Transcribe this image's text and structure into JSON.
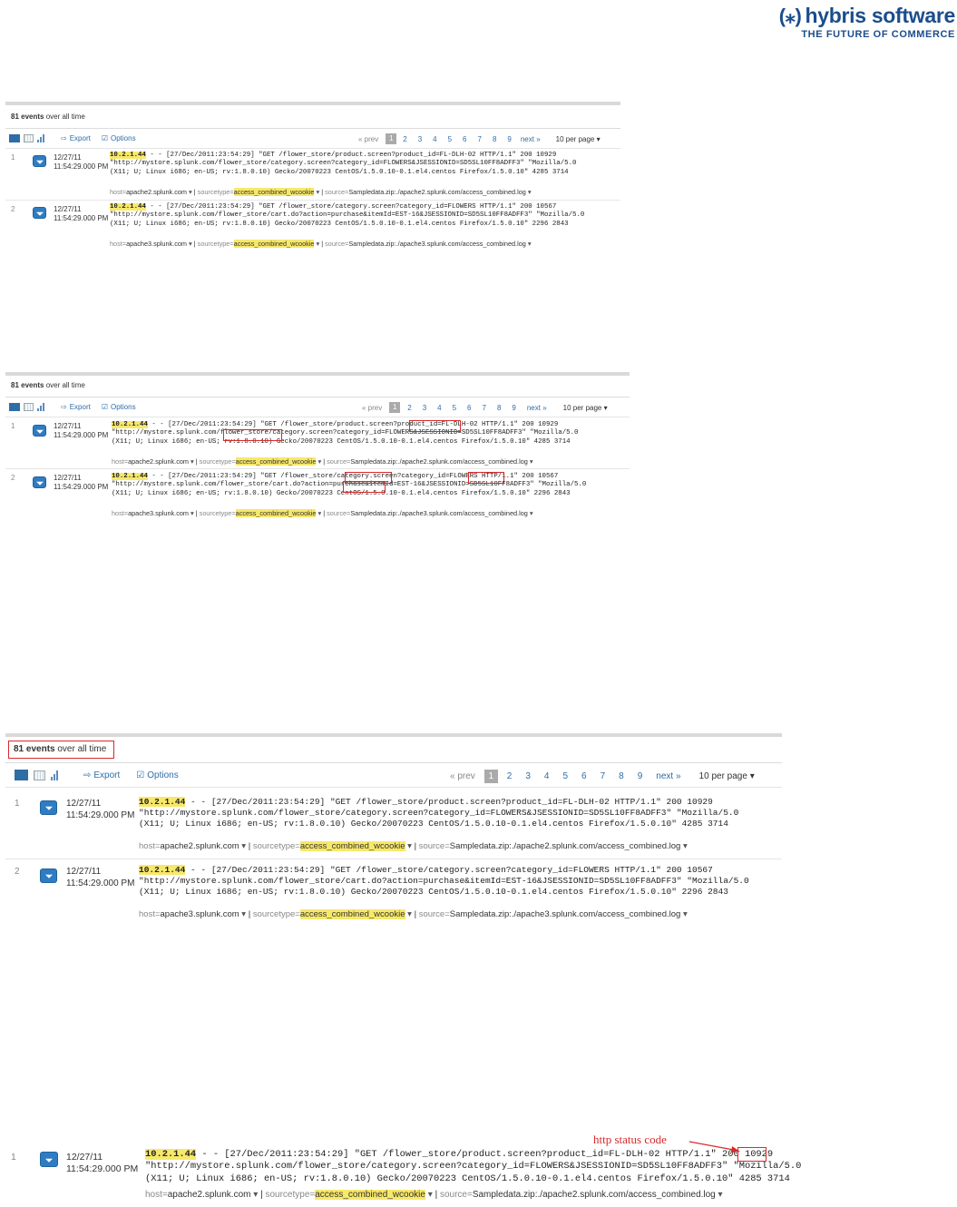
{
  "logo": {
    "name": "hybris software",
    "tagline": "THE FUTURE OF COMMERCE"
  },
  "screens": [
    {
      "count": {
        "num": "81 events",
        "rest": " over all time"
      },
      "toolbar": {
        "export": "Export",
        "options": "Options"
      },
      "pager": {
        "prev": "« prev",
        "pages": [
          "1",
          "2",
          "3",
          "4",
          "5",
          "6",
          "7",
          "8",
          "9"
        ],
        "next": "next »",
        "per_page": "10 per page"
      },
      "events": [
        {
          "num": "1",
          "date": "12/27/11",
          "time": "11:54:29.000 PM",
          "ip": "10.2.1.44",
          "line1": " - - [27/Dec/2011:23:54:29] \"GET /flower_store/product.screen?product_id=FL-DLH-02 HTTP/1.1\" 200 10929",
          "line2": "\"http://mystore.splunk.com/flower_store/category.screen?category_id=FLOWERS&JSESSIONID=SD5SL10FF8ADFF3\" \"Mozilla/5.0",
          "line3": "(X11; U; Linux i686; en-US; rv:1.8.0.10) Gecko/20070223 CentOS/1.5.0.10-0.1.el4.centos Firefox/1.5.0.10\" 4285 3714",
          "host": "apache2.splunk.com",
          "sourcetype": "access_combined_wcookie",
          "source": "Sampledata.zip:./apache2.splunk.com/access_combined.log"
        },
        {
          "num": "2",
          "date": "12/27/11",
          "time": "11:54:29.000 PM",
          "ip": "10.2.1.44",
          "line1": " - - [27/Dec/2011:23:54:29] \"GET /flower_store/category.screen?category_id=FLOWERS HTTP/1.1\" 200 10567",
          "line2": "\"http://mystore.splunk.com/flower_store/cart.do?action=purchase&itemId=EST-16&JSESSIONID=SD5SL10FF8ADFF3\" \"Mozilla/5.0",
          "line3": "(X11; U; Linux i686; en-US; rv:1.8.0.10) Gecko/20070223 CentOS/1.5.0.10-0.1.el4.centos Firefox/1.5.0.10\" 2296 2843",
          "host": "apache3.splunk.com",
          "sourcetype": "access_combined_wcookie",
          "source": "Sampledata.zip:./apache3.splunk.com/access_combined.log"
        }
      ]
    }
  ],
  "fields": {
    "host": "host=",
    "sourcetype": "sourcetype=",
    "source": "source=",
    "sep": "|",
    "dd": "▾"
  },
  "annotation": {
    "http_status": "http status code",
    "status_value": "200"
  }
}
